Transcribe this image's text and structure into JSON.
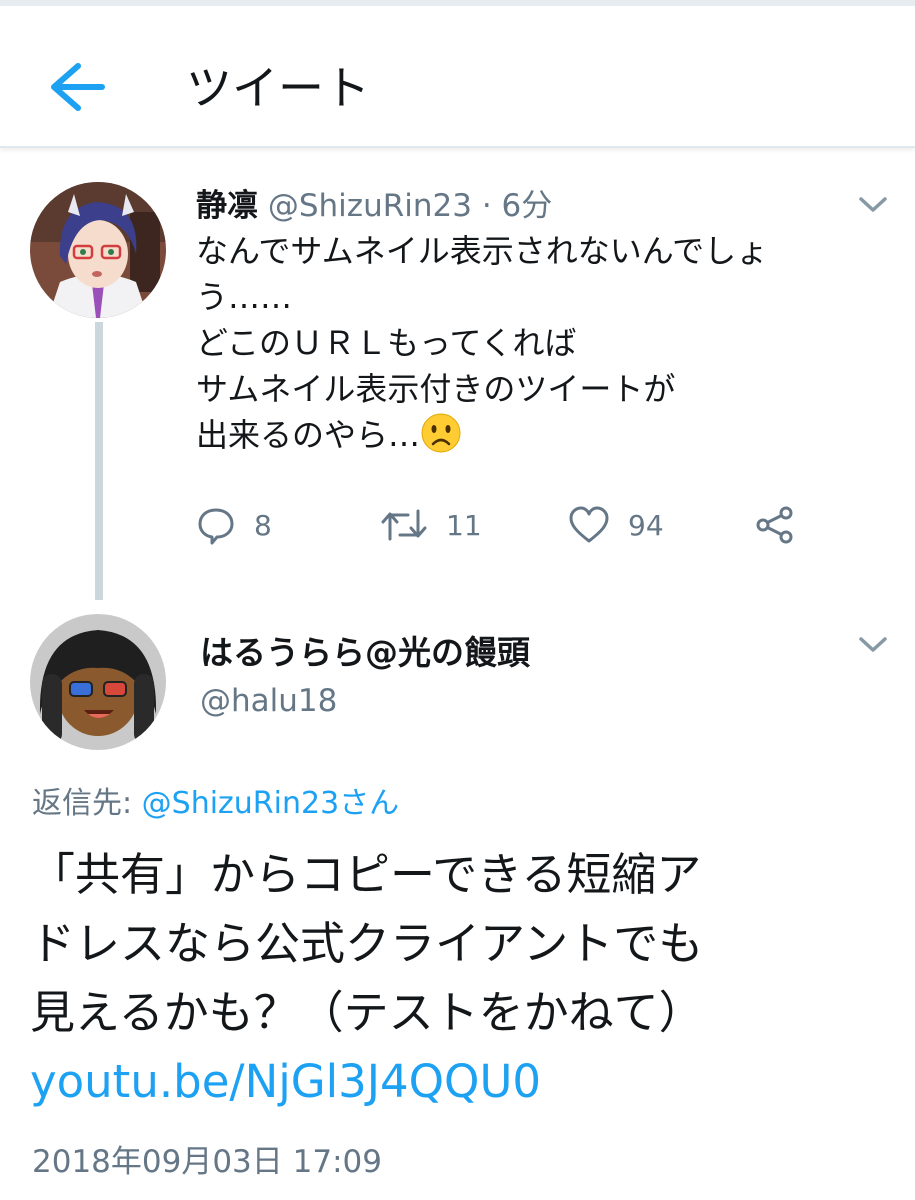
{
  "header": {
    "title": "ツイート"
  },
  "tweet1": {
    "name": "静凛",
    "handle": "@ShizuRin23",
    "dot": "·",
    "time": "6分",
    "lines": [
      "なんでサムネイル表示されないんでしょ",
      "う……",
      "どこのＵＲＬもってくれば",
      "サムネイル表示付きのツイートが",
      "出来るのやら…"
    ],
    "emoji": "worried-face-emoji",
    "actions": {
      "reply_count": "8",
      "retweet_count": "11",
      "like_count": "94"
    }
  },
  "tweet2": {
    "name": "はるうらら@光の饅頭",
    "handle": "@halu18",
    "replying_prefix": "返信先: ",
    "replying_to": "@ShizuRin23さん",
    "lines": [
      "「共有」からコピーできる短縮ア",
      "ドレスなら公式クライアントでも",
      "見えるかも？（テストをかねて）"
    ],
    "link": "youtu.be/NjGl3J4QQU0",
    "timestamp": "2018年09月03日 17:09"
  },
  "icons": [
    "back-arrow-icon",
    "chevron-down-icon",
    "reply-icon",
    "retweet-icon",
    "like-icon",
    "share-icon"
  ],
  "colors": {
    "accent": "#1da1f2",
    "secondary_text": "#657786",
    "primary_text": "#14171a",
    "thread_line": "#ccd6dd"
  }
}
